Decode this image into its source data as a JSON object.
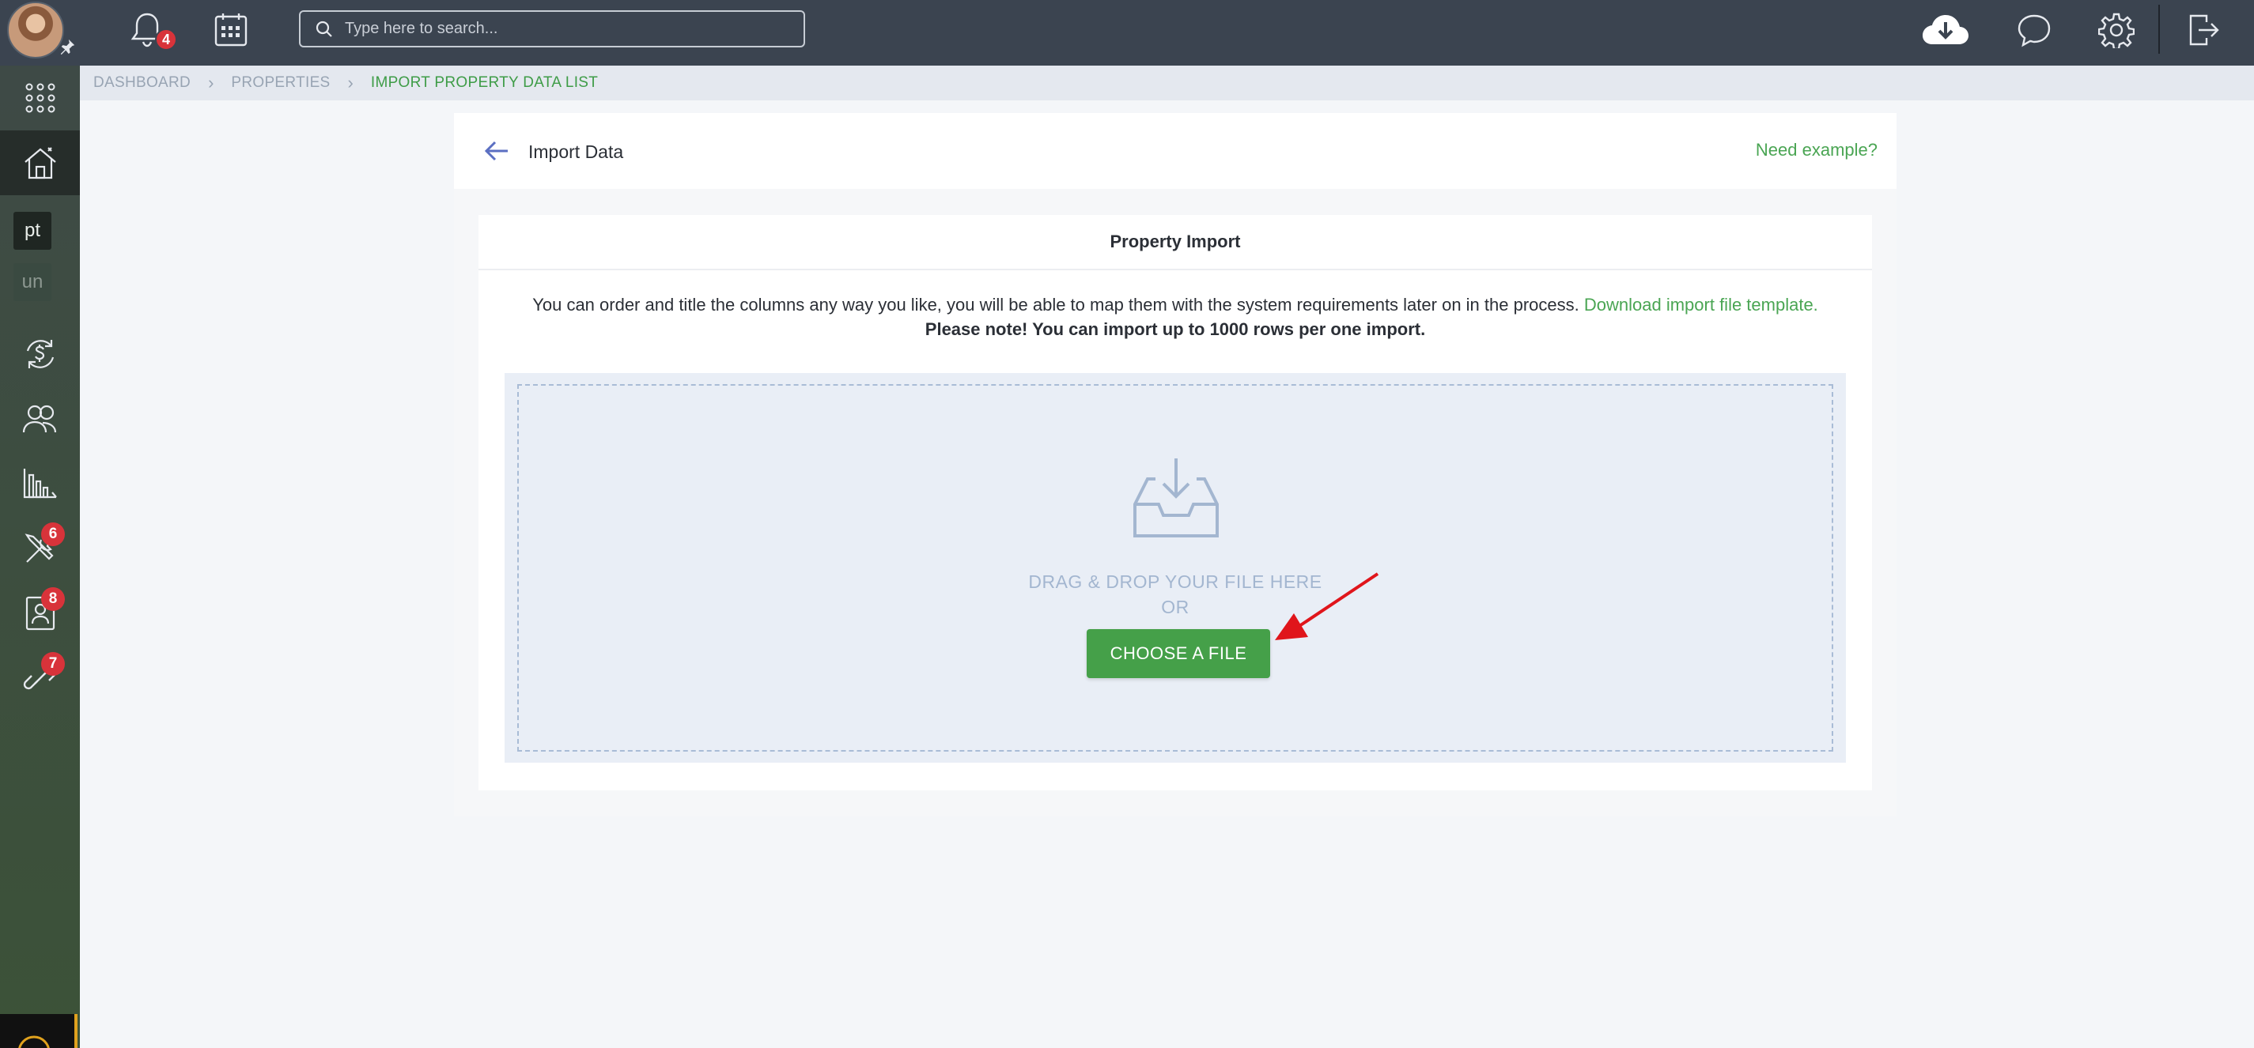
{
  "topbar": {
    "notifications_count": "4",
    "search_placeholder": "Type here to search..."
  },
  "sidebar": {
    "tags": [
      "pt",
      "un"
    ],
    "badges": {
      "tools": "6",
      "contacts": "8",
      "integrations": "7"
    }
  },
  "breadcrumb": [
    "DASHBOARD",
    "PROPERTIES",
    "IMPORT PROPERTY DATA LIST"
  ],
  "header": {
    "title": "Import Data",
    "need_example": "Need example?"
  },
  "card": {
    "title": "Property Import",
    "description": "You can order and title the columns any way you like, you will be able to map them with the system requirements later on in the process.",
    "template_link": "Download import file template.",
    "note": "Please note! You can import up to 1000 rows per one import."
  },
  "dropzone": {
    "drag_text": "DRAG & DROP YOUR FILE HERE",
    "or_text": "OR",
    "button_label": "CHOOSE A FILE"
  },
  "colors": {
    "accent_green": "#45a049",
    "topbar": "#3b4450",
    "badge_red": "#d8333a"
  }
}
